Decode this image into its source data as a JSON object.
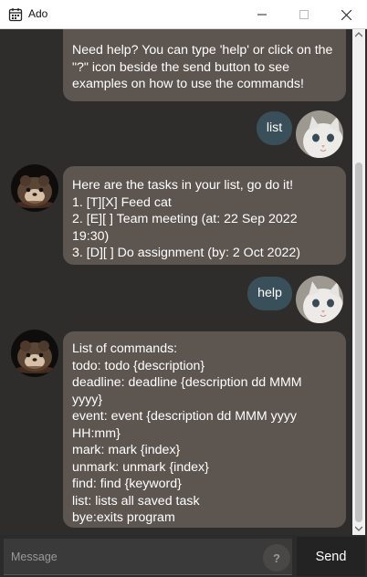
{
  "window": {
    "title": "Ado"
  },
  "messages": {
    "m1": "Need help? You can type 'help' or click on the\n\"?\" icon beside the send button to see\nexamples on how to use the commands!",
    "u1": "list",
    "m2": "Here are the tasks in your list, go do it!\n1. [T][X] Feed cat\n2. [E][ ] Team meeting (at: 22 Sep 2022\n19:30)\n3. [D][ ] Do assignment (by: 2 Oct 2022)",
    "u2": "help",
    "m3": "List of commands:\ntodo: todo {description}\ndeadline: deadline {description dd MMM\nyyyy}\nevent: event {description dd MMM yyyy\nHH:mm}\nmark: mark {index}\nunmark: unmark {index}\nfind: find {keyword}\nlist: lists all saved task\nbye:exits program"
  },
  "input": {
    "placeholder": "Message",
    "help_label": "?",
    "send_label": "Send"
  },
  "colors": {
    "bot_bubble": "#5d5550",
    "user_bubble": "#39505a",
    "background": "#2e2d2b"
  },
  "icons": [
    "calendar-icon",
    "minimize-icon",
    "maximize-icon",
    "close-icon",
    "bot-avatar",
    "user-cat-avatar"
  ]
}
